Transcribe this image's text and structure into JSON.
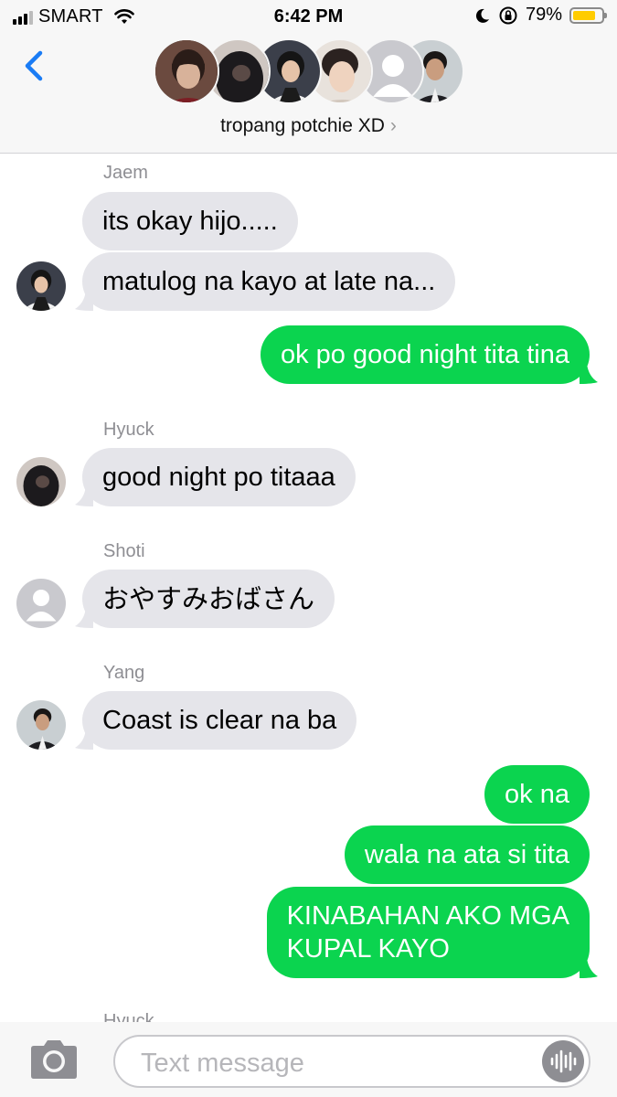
{
  "status_bar": {
    "carrier": "SMART",
    "time": "6:42 PM",
    "battery_percent": "79%",
    "battery_level": 0.79,
    "battery_color": "#ffcc00"
  },
  "header": {
    "group_name": "tropang potchie XD",
    "chevron": "›",
    "avatar_count": 6
  },
  "messages": [
    {
      "sender": "Jaem",
      "text": "its okay hijo.....",
      "direction": "incoming"
    },
    {
      "text": "matulog na kayo at late na...",
      "direction": "incoming"
    },
    {
      "text": "ok po good night tita tina",
      "direction": "outgoing"
    },
    {
      "sender": "Hyuck",
      "text": "good night po titaaa",
      "direction": "incoming"
    },
    {
      "sender": "Shoti",
      "text": "おやすみおばさん",
      "direction": "incoming"
    },
    {
      "sender": "Yang",
      "text": "Coast is clear na ba",
      "direction": "incoming"
    },
    {
      "text": "ok na",
      "direction": "outgoing"
    },
    {
      "text": "wala na ata si tita",
      "direction": "outgoing"
    },
    {
      "text_lines": [
        "KINABAHAN AKO MGA",
        "KUPAL KAYO"
      ],
      "direction": "outgoing"
    },
    {
      "sender": "Hyuck",
      "direction": "incoming"
    }
  ],
  "input": {
    "placeholder": "Text message",
    "value": ""
  },
  "colors": {
    "outgoing_bubble": "#0bd44f",
    "incoming_bubble": "#e5e5ea",
    "accent": "#1a7cf5"
  },
  "icons": [
    "back-chevron-icon",
    "camera-icon",
    "audio-waveform-icon",
    "wifi-icon",
    "moon-icon",
    "rotation-lock-icon"
  ]
}
